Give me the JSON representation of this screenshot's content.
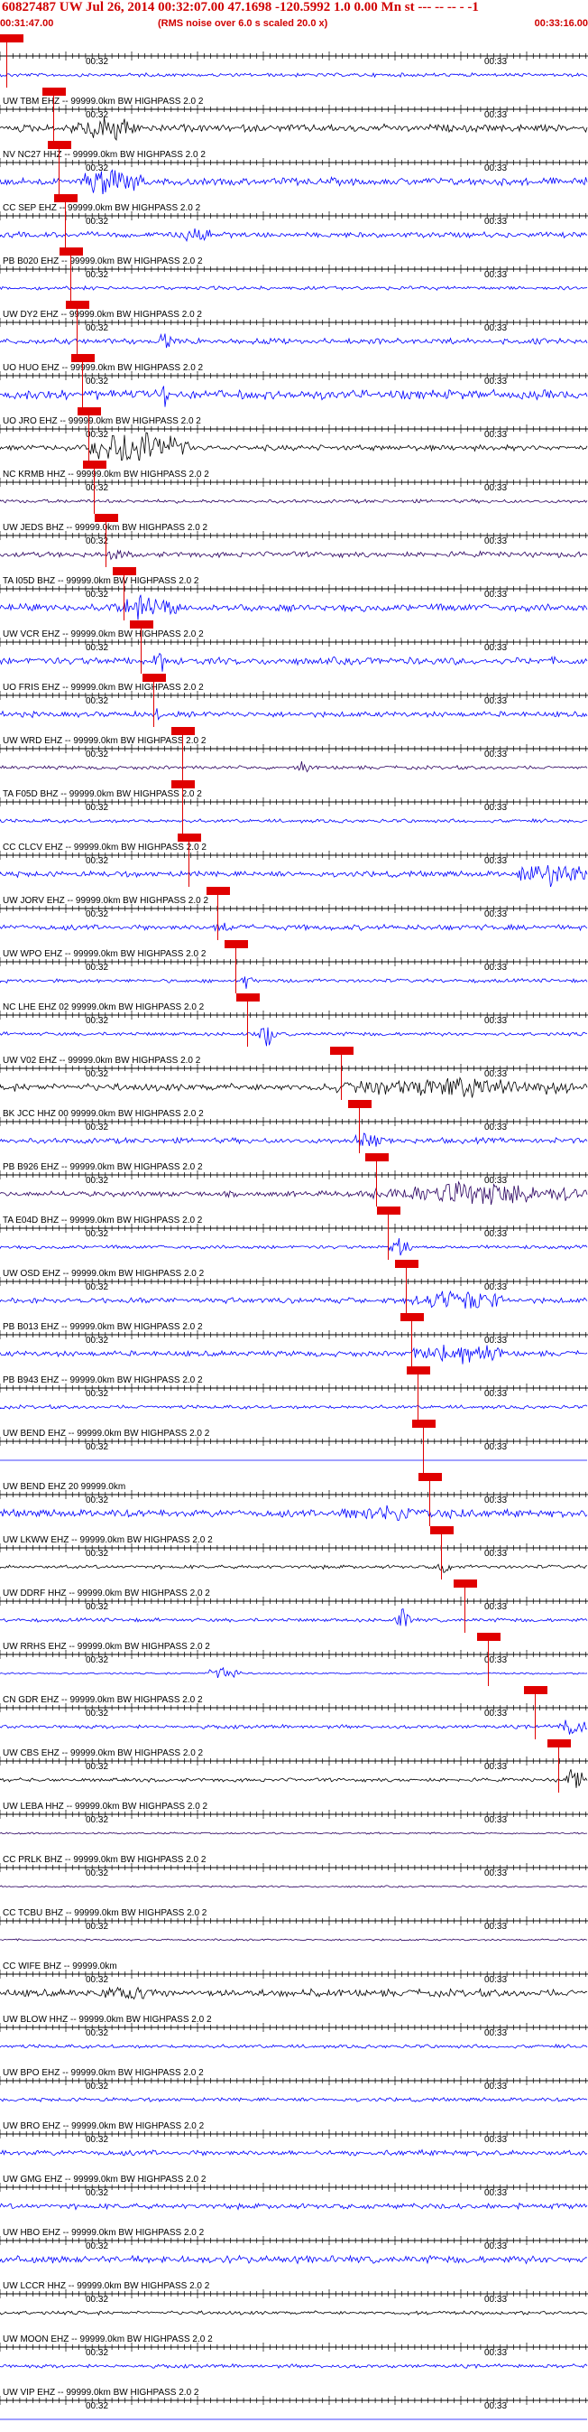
{
  "header": {
    "title": "60827487 UW Jul 26, 2014 00:32:07.00   47.1698 -120.5992  1.0 0.00 Mn st --- -- -- - -1",
    "start_time": "00:31:47.00",
    "rms_note": "(RMS noise over 6.0 s scaled 20.0 x)",
    "end_time": "00:33:16.00"
  },
  "tick_labels": {
    "first": "00:32",
    "second": "00:33"
  },
  "colors": {
    "pick": "#e00000",
    "blue": "#0000ff",
    "black": "#000000",
    "purple": "#2a0060"
  },
  "traces": [
    {
      "label": "",
      "color": "blue",
      "amp": 2,
      "burst": [],
      "pick": 0.01
    },
    {
      "label": "UW TBM EHZ -- 99999.0km BW  HIGHPASS  2.0  2",
      "color": "black",
      "amp": 4,
      "burst": [
        0.12,
        0.24,
        18
      ],
      "pick": 0.09
    },
    {
      "label": "NV NC27 HHZ -- 99999.0km BW  HIGHPASS  2.0  2",
      "color": "blue",
      "amp": 4,
      "burst": [
        0.14,
        0.24,
        22
      ],
      "pick": 0.1
    },
    {
      "label": "CC SEP EHZ -- 99999.0km BW  HIGHPASS  2.0  2",
      "color": "blue",
      "amp": 3,
      "burst": [
        0.3,
        0.36,
        12
      ],
      "pick": 0.11
    },
    {
      "label": "PB B020 EHZ -- 99999.0km BW  HIGHPASS  2.0  2",
      "color": "blue",
      "amp": 2,
      "burst": [],
      "pick": 0.12
    },
    {
      "label": "UW DY2 EHZ -- 99999.0km BW  HIGHPASS  2.0  2",
      "color": "blue",
      "amp": 3,
      "burst": [
        0.27,
        0.29,
        14
      ],
      "pick": 0.13
    },
    {
      "label": "UO HUO EHZ -- 99999.0km BW  HIGHPASS  2.0  2",
      "color": "blue",
      "amp": 5,
      "burst": [
        0.27,
        0.29,
        16
      ],
      "pick": 0.14
    },
    {
      "label": "UO JRO EHZ -- 99999.0km BW  HIGHPASS  2.0  2",
      "color": "black",
      "amp": 3,
      "burst": [
        0.15,
        0.32,
        26
      ],
      "pick": 0.15
    },
    {
      "label": "NC KRMB HHZ -- 99999.0km BW  HIGHPASS  2.0  2",
      "color": "purple",
      "amp": 2,
      "burst": [],
      "pick": 0.16
    },
    {
      "label": "UW JEDS BHZ -- 99999.0km BW  HIGHPASS  2.0  2",
      "color": "purple",
      "amp": 3,
      "burst": [
        0.18,
        0.22,
        10
      ],
      "pick": 0.18
    },
    {
      "label": "TA I05D BHZ -- 99999.0km BW  HIGHPASS  2.0  2",
      "color": "blue",
      "amp": 4,
      "burst": [
        0.2,
        0.3,
        18
      ],
      "pick": 0.21
    },
    {
      "label": "UW VCR EHZ -- 99999.0km BW  HIGHPASS  2.0  2",
      "color": "blue",
      "amp": 4,
      "burst": [
        0.26,
        0.29,
        16
      ],
      "pick": 0.24
    },
    {
      "label": "UO FRIS EHZ -- 99999.0km BW  HIGHPASS  2.0  2",
      "color": "blue",
      "amp": 3,
      "burst": [
        0.26,
        0.28,
        12
      ],
      "pick": 0.26
    },
    {
      "label": "UW WRD EHZ -- 99999.0km BW  HIGHPASS  2.0  2",
      "color": "purple",
      "amp": 2,
      "burst": [
        0.5,
        0.53,
        8
      ],
      "pick": 0.31
    },
    {
      "label": "TA F05D BHZ -- 99999.0km BW  HIGHPASS  2.0  2",
      "color": "blue",
      "amp": 2,
      "burst": [],
      "pick": 0.31
    },
    {
      "label": "CC CLCV EHZ -- 99999.0km BW  HIGHPASS  2.0  2",
      "color": "blue",
      "amp": 3,
      "burst": [
        0.88,
        1.0,
        20
      ],
      "pick": 0.32
    },
    {
      "label": "UW JORV EHZ -- 99999.0km BW  HIGHPASS  2.0  2",
      "color": "blue",
      "amp": 3,
      "burst": [
        0.36,
        0.4,
        8
      ],
      "pick": 0.37
    },
    {
      "label": "UW WPO EHZ -- 99999.0km BW  HIGHPASS  2.0  2",
      "color": "blue",
      "amp": 2,
      "burst": [
        0.41,
        0.43,
        12
      ],
      "pick": 0.4
    },
    {
      "label": "NC LHE EHZ 02 99999.0km BW  HIGHPASS  2.0  2",
      "color": "blue",
      "amp": 2,
      "burst": [
        0.44,
        0.47,
        18
      ],
      "pick": 0.42
    },
    {
      "label": "UW V02 EHZ -- 99999.0km BW  HIGHPASS  2.0  2",
      "color": "black",
      "amp": 4,
      "burst": [
        0.55,
        1.0,
        14
      ],
      "pick": 0.58
    },
    {
      "label": "BK JCC HHZ 00 99999.0km BW  HIGHPASS  2.0  2",
      "color": "blue",
      "amp": 3,
      "burst": [
        0.6,
        0.66,
        12
      ],
      "pick": 0.61
    },
    {
      "label": "PB B926 EHZ -- 99999.0km BW  HIGHPASS  2.0  2",
      "color": "purple",
      "amp": 3,
      "burst": [
        0.63,
        1.0,
        16
      ],
      "pick": 0.64
    },
    {
      "label": "TA E04D BHZ -- 99999.0km BW  HIGHPASS  2.0  2",
      "color": "blue",
      "amp": 2,
      "burst": [
        0.66,
        0.7,
        12
      ],
      "pick": 0.66
    },
    {
      "label": "UW OSD EHZ -- 99999.0km BW  HIGHPASS  2.0  2",
      "color": "blue",
      "amp": 3,
      "burst": [
        0.7,
        0.86,
        16
      ],
      "pick": 0.69
    },
    {
      "label": "PB B013 EHZ -- 99999.0km BW  HIGHPASS  2.0  2",
      "color": "blue",
      "amp": 3,
      "burst": [
        0.7,
        0.86,
        16
      ],
      "pick": 0.7
    },
    {
      "label": "PB B943 EHZ -- 99999.0km BW  HIGHPASS  2.0  2",
      "color": "blue",
      "amp": 2,
      "burst": [],
      "pick": 0.71
    },
    {
      "label": "UW BEND EHZ -- 99999.0km BW  HIGHPASS  2.0  2",
      "color": "blue",
      "amp": 0,
      "burst": [],
      "pick": 0.72
    },
    {
      "label": "UW BEND EHZ 20 99999.0km",
      "color": "blue",
      "amp": 4,
      "burst": [
        0.55,
        0.8,
        12
      ],
      "pick": 0.73
    },
    {
      "label": "UW LKWW EHZ -- 99999.0km BW  HIGHPASS  2.0  2",
      "color": "black",
      "amp": 2,
      "burst": [
        0.74,
        0.77,
        8
      ],
      "pick": 0.75
    },
    {
      "label": "UW DDRF HHZ -- 99999.0km BW  HIGHPASS  2.0  2",
      "color": "blue",
      "amp": 2,
      "burst": [
        0.67,
        0.7,
        16
      ],
      "pick": 0.79
    },
    {
      "label": "UW RRHS EHZ -- 99999.0km BW  HIGHPASS  2.0  2",
      "color": "blue",
      "amp": 1,
      "burst": [
        0.35,
        0.41,
        10
      ],
      "pick": 0.83
    },
    {
      "label": "CN GDR EHZ -- 99999.0km BW  HIGHPASS  2.0  2",
      "color": "blue",
      "amp": 2,
      "burst": [
        0.95,
        1.0,
        14
      ],
      "pick": 0.91
    },
    {
      "label": "UW CBS EHZ -- 99999.0km BW  HIGHPASS  2.0  2",
      "color": "black",
      "amp": 2,
      "burst": [
        0.96,
        0.99,
        20
      ],
      "pick": 0.95
    },
    {
      "label": "UW LEBA HHZ -- 99999.0km BW  HIGHPASS  2.0  2",
      "color": "purple",
      "amp": 1,
      "burst": [],
      "pick": null
    },
    {
      "label": "CC PRLK BHZ -- 99999.0km BW  HIGHPASS  2.0  2",
      "color": "purple",
      "amp": 1,
      "burst": [],
      "pick": null
    },
    {
      "label": "CC TCBU BHZ -- 99999.0km BW  HIGHPASS  2.0  2",
      "color": "purple",
      "amp": 1,
      "burst": [],
      "pick": null
    },
    {
      "label": "CC WIFE BHZ -- 99999.0km",
      "color": "black",
      "amp": 4,
      "burst": [
        0.15,
        0.3,
        10
      ],
      "pick": null
    },
    {
      "label": "UW BLOW HHZ -- 99999.0km BW  HIGHPASS  2.0  2",
      "color": "blue",
      "amp": 2,
      "burst": [],
      "pick": null
    },
    {
      "label": "UW BPO EHZ -- 99999.0km BW  HIGHPASS  2.0  2",
      "color": "blue",
      "amp": 2,
      "burst": [],
      "pick": null
    },
    {
      "label": "UW BRO EHZ -- 99999.0km BW  HIGHPASS  2.0  2",
      "color": "blue",
      "amp": 3,
      "burst": [],
      "pick": null
    },
    {
      "label": "UW GMG EHZ -- 99999.0km BW  HIGHPASS  2.0  2",
      "color": "blue",
      "amp": 3,
      "burst": [],
      "pick": null
    },
    {
      "label": "UW HBO EHZ -- 99999.0km BW  HIGHPASS  2.0  2",
      "color": "blue",
      "amp": 4,
      "burst": [],
      "pick": null
    },
    {
      "label": "UW LCCR HHZ -- 99999.0km BW  HIGHPASS  2.0  2",
      "color": "black",
      "amp": 2,
      "burst": [],
      "pick": null
    },
    {
      "label": "UW MOON EHZ -- 99999.0km BW  HIGHPASS  2.0  2",
      "color": "blue",
      "amp": 2,
      "burst": [],
      "pick": null
    },
    {
      "label": "UW VIP EHZ -- 99999.0km BW  HIGHPASS  2.0  2",
      "color": "blue",
      "amp": 0,
      "burst": [],
      "pick": null
    }
  ]
}
